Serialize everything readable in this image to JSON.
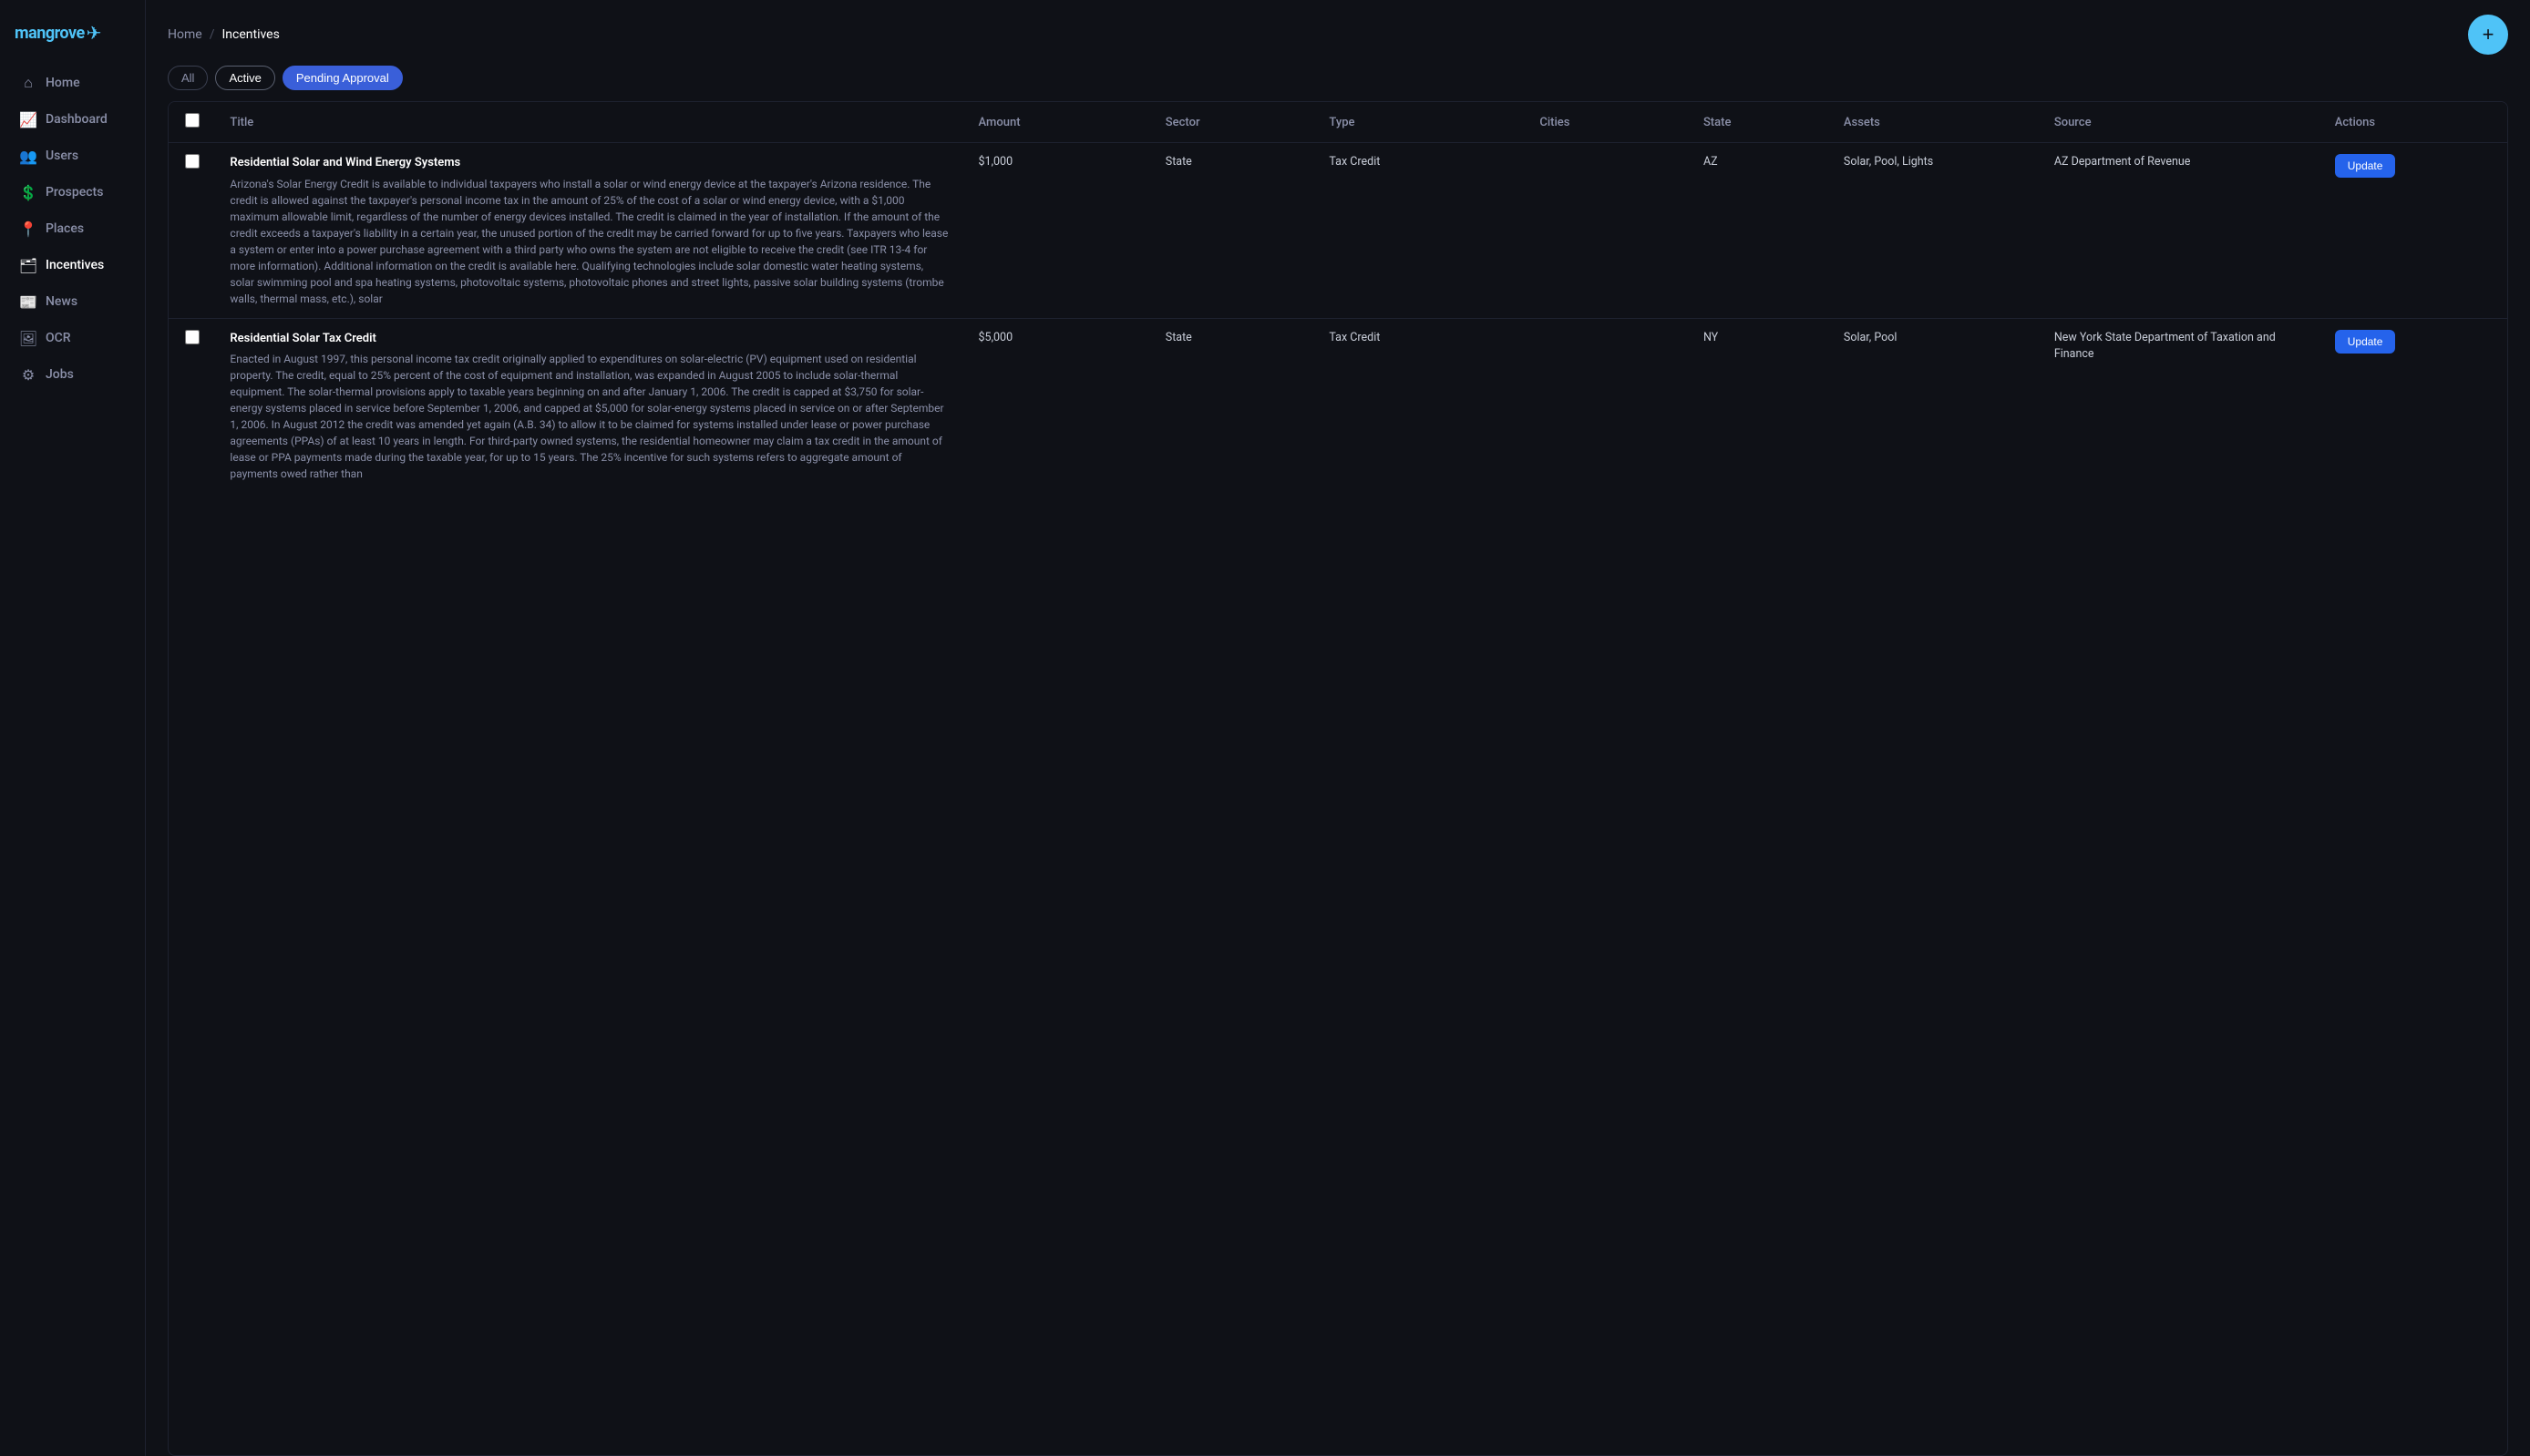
{
  "app": {
    "logo": "mangrove",
    "logo_icon": "✈"
  },
  "sidebar": {
    "items": [
      {
        "id": "home",
        "label": "Home",
        "icon": "⌂",
        "active": false
      },
      {
        "id": "dashboard",
        "label": "Dashboard",
        "icon": "📈",
        "active": false
      },
      {
        "id": "users",
        "label": "Users",
        "icon": "👥",
        "active": false
      },
      {
        "id": "prospects",
        "label": "Prospects",
        "icon": "💲",
        "active": false
      },
      {
        "id": "places",
        "label": "Places",
        "icon": "📍",
        "active": false
      },
      {
        "id": "incentives",
        "label": "Incentives",
        "icon": "🗂",
        "active": true
      },
      {
        "id": "news",
        "label": "News",
        "icon": "📰",
        "active": false
      },
      {
        "id": "ocr",
        "label": "OCR",
        "icon": "🖼",
        "active": false
      },
      {
        "id": "jobs",
        "label": "Jobs",
        "icon": "⚙",
        "active": false
      }
    ]
  },
  "header": {
    "breadcrumb_home": "Home",
    "breadcrumb_sep": "/",
    "breadcrumb_current": "Incentives",
    "fab_label": "+"
  },
  "filters": {
    "all_label": "All",
    "active_label": "Active",
    "pending_label": "Pending Approval"
  },
  "table": {
    "columns": [
      "",
      "Title",
      "Amount",
      "Sector",
      "Type",
      "Cities",
      "State",
      "Assets",
      "Source",
      "Actions"
    ],
    "rows": [
      {
        "id": "row1",
        "title": "Residential Solar and Wind Energy Systems",
        "description": "Arizona's Solar Energy Credit is available to individual taxpayers who install a solar or wind energy device at the taxpayer's Arizona residence. The credit is allowed against the taxpayer's personal income tax in the amount of 25% of the cost of a solar or wind energy device, with a $1,000 maximum allowable limit, regardless of the number of energy devices installed. The credit is claimed in the year of installation. If the amount of the credit exceeds a taxpayer's liability in a certain year, the unused portion of the credit may be carried forward for up to five years. Taxpayers who lease a system or enter into a power purchase agreement with a third party who owns the system are not eligible to receive the credit (see ITR 13-4 for more information). Additional information on the credit is available here. Qualifying technologies include solar domestic water heating systems, solar swimming pool and spa heating systems, photovoltaic systems, photovoltaic phones and street lights, passive solar building systems (trombe walls, thermal mass, etc.), solar",
        "amount": "$1,000",
        "sector": "State",
        "type": "Tax Credit",
        "cities": "",
        "state": "AZ",
        "assets": "Solar, Pool, Lights",
        "source": "AZ Department of Revenue",
        "action": "Update"
      },
      {
        "id": "row2",
        "title": "Residential Solar Tax Credit",
        "description": "Enacted in August 1997, this personal income tax credit originally applied to expenditures on solar-electric (PV) equipment used on residential property. The credit, equal to 25% percent of the cost of equipment and installation, was expanded in August 2005 to include solar-thermal equipment. The solar-thermal provisions apply to taxable years beginning on and after January 1, 2006. The credit is capped at $3,750 for solar-energy systems placed in service before September 1, 2006, and capped at $5,000 for solar-energy systems placed in service on or after September 1, 2006. In August 2012 the credit was amended yet again (A.B. 34) to allow it to be claimed for systems installed under lease or power purchase agreements (PPAs) of at least 10 years in length. For third-party owned systems, the residential homeowner may claim a tax credit in the amount of lease or PPA payments made during the taxable year, for up to 15 years. The 25% incentive for such systems refers to aggregate amount of payments owed rather than",
        "amount": "$5,000",
        "sector": "State",
        "type": "Tax Credit",
        "cities": "",
        "state": "NY",
        "assets": "Solar, Pool",
        "source": "New York State Department of Taxation and Finance",
        "action": "Update"
      }
    ]
  }
}
